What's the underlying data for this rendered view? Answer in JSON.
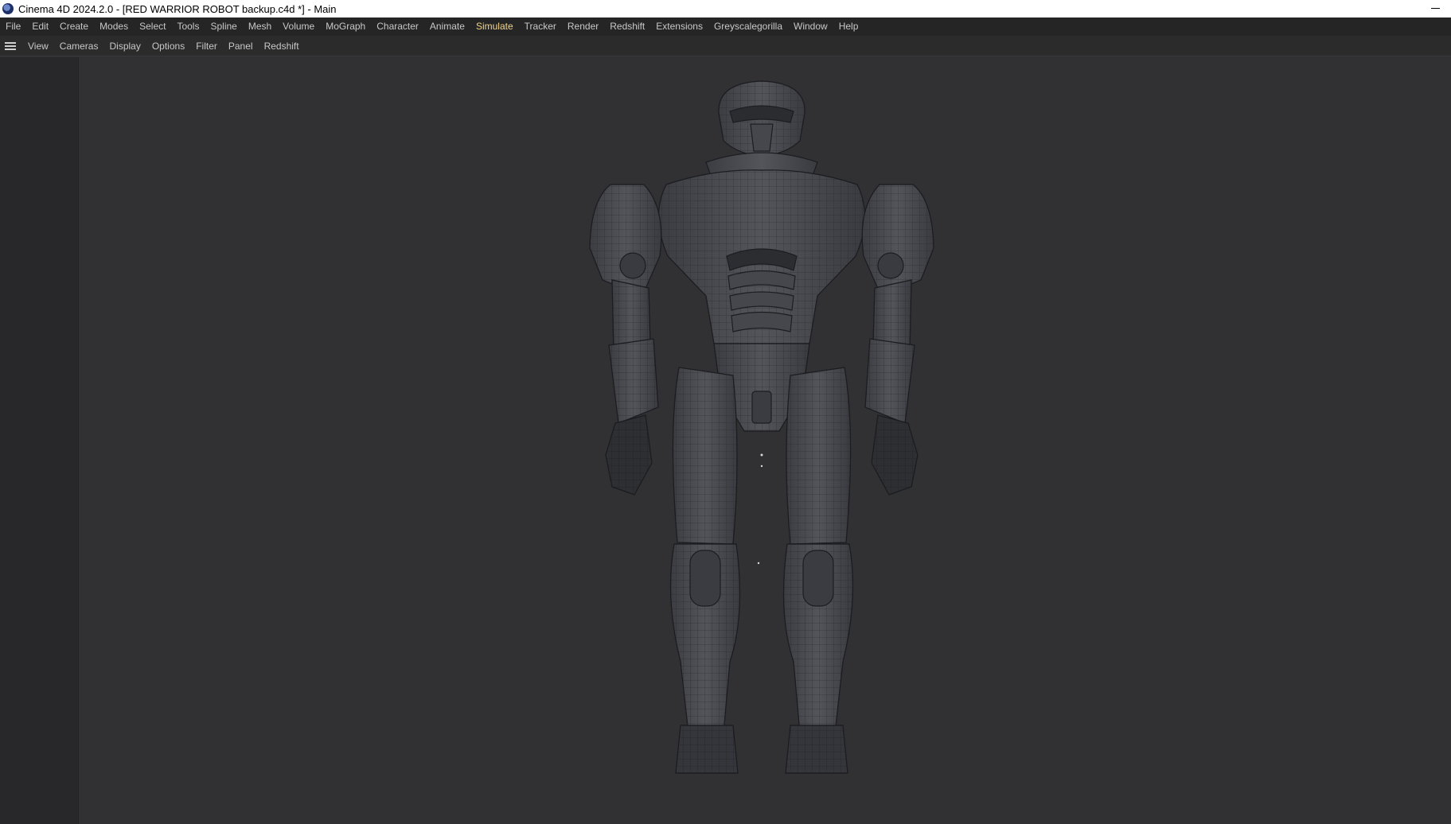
{
  "window": {
    "title": "Cinema 4D 2024.2.0 - [RED WARRIOR ROBOT backup.c4d *] - Main"
  },
  "menubar": {
    "items": [
      {
        "label": "File"
      },
      {
        "label": "Edit"
      },
      {
        "label": "Create"
      },
      {
        "label": "Modes"
      },
      {
        "label": "Select"
      },
      {
        "label": "Tools"
      },
      {
        "label": "Spline"
      },
      {
        "label": "Mesh"
      },
      {
        "label": "Volume"
      },
      {
        "label": "MoGraph"
      },
      {
        "label": "Character"
      },
      {
        "label": "Animate"
      },
      {
        "label": "Simulate",
        "active": true
      },
      {
        "label": "Tracker"
      },
      {
        "label": "Render"
      },
      {
        "label": "Redshift"
      },
      {
        "label": "Extensions"
      },
      {
        "label": "Greyscalegorilla"
      },
      {
        "label": "Window"
      },
      {
        "label": "Help"
      }
    ],
    "active_color": "#f2d58a"
  },
  "viewport_menu": {
    "items": [
      {
        "label": "View"
      },
      {
        "label": "Cameras"
      },
      {
        "label": "Display"
      },
      {
        "label": "Options"
      },
      {
        "label": "Filter"
      },
      {
        "label": "Panel"
      },
      {
        "label": "Redshift"
      }
    ]
  },
  "viewport": {
    "subject": "robot-wireframe-model",
    "background_color": "#313134"
  },
  "icons": [
    "cinema4d-app-icon",
    "minimize-icon",
    "hamburger-menu-icon"
  ]
}
